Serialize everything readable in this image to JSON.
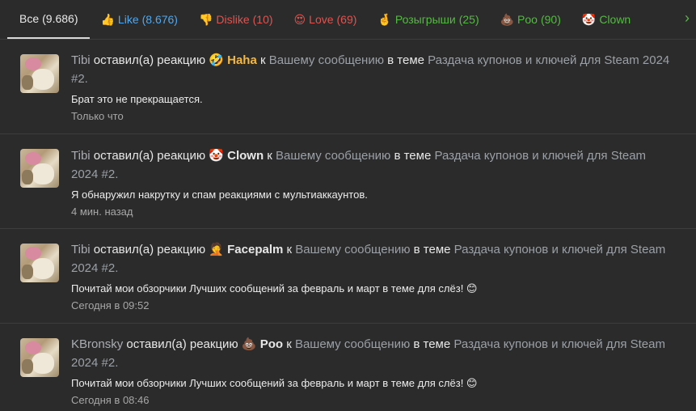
{
  "tabs": [
    {
      "label": "Все",
      "count": "(9.686)",
      "emoji": "",
      "color": "#eaeaea",
      "active": true
    },
    {
      "label": "Like",
      "count": "(8.676)",
      "emoji": "👍",
      "color": "#4fa8f0"
    },
    {
      "label": "Dislike",
      "count": "(10)",
      "emoji": "👎",
      "color": "#e0534f"
    },
    {
      "label": "Love",
      "count": "(69)",
      "emoji": "😍",
      "color": "#e0534f"
    },
    {
      "label": "Розыгрыши",
      "count": "(25)",
      "emoji": "🤞",
      "color": "#57b846"
    },
    {
      "label": "Poo",
      "count": "(90)",
      "emoji": "💩",
      "color": "#57b846"
    },
    {
      "label": "Clown",
      "count": "",
      "emoji": "🤡",
      "color": "#57b846"
    }
  ],
  "next_arrow": "›",
  "items": [
    {
      "user": "Tibi",
      "action": "оставил(а) реакцию",
      "emoji": "🤣",
      "reaction": "Haha",
      "to": "к",
      "target": "Вашему сообщению",
      "in_thread": "в теме",
      "thread": "Раздача купонов и ключей для Steam 2024 #2.",
      "message": "Брат это не прекращается.",
      "time": "Только что"
    },
    {
      "user": "Tibi",
      "action": "оставил(а) реакцию",
      "emoji": "🤡",
      "reaction": "Clown",
      "to": "к",
      "target": "Вашему сообщению",
      "in_thread": "в теме",
      "thread": "Раздача купонов и ключей для Steam 2024 #2.",
      "message": "Я обнаружил накрутку и спам реакциями с мультиаккаунтов.",
      "time": "4 мин. назад"
    },
    {
      "user": "Tibi",
      "action": "оставил(а) реакцию",
      "emoji": "🤦",
      "reaction": "Facepalm",
      "to": "к",
      "target": "Вашему сообщению",
      "in_thread": "в теме",
      "thread": "Раздача купонов и ключей для Steam 2024 #2.",
      "message": "Почитай мои обзорчики Лучших сообщений за февраль и март в теме для слёз! 😊",
      "time": "Сегодня в 09:52"
    },
    {
      "user": "KBronsky",
      "action": "оставил(а) реакцию",
      "emoji": "💩",
      "reaction": "Poo",
      "to": "к",
      "target": "Вашему сообщению",
      "in_thread": "в теме",
      "thread": "Раздача купонов и ключей для Steam 2024 #2.",
      "message": "Почитай мои обзорчики Лучших сообщений за февраль и март в теме для слёз! 😊",
      "time": "Сегодня в 08:46"
    }
  ]
}
